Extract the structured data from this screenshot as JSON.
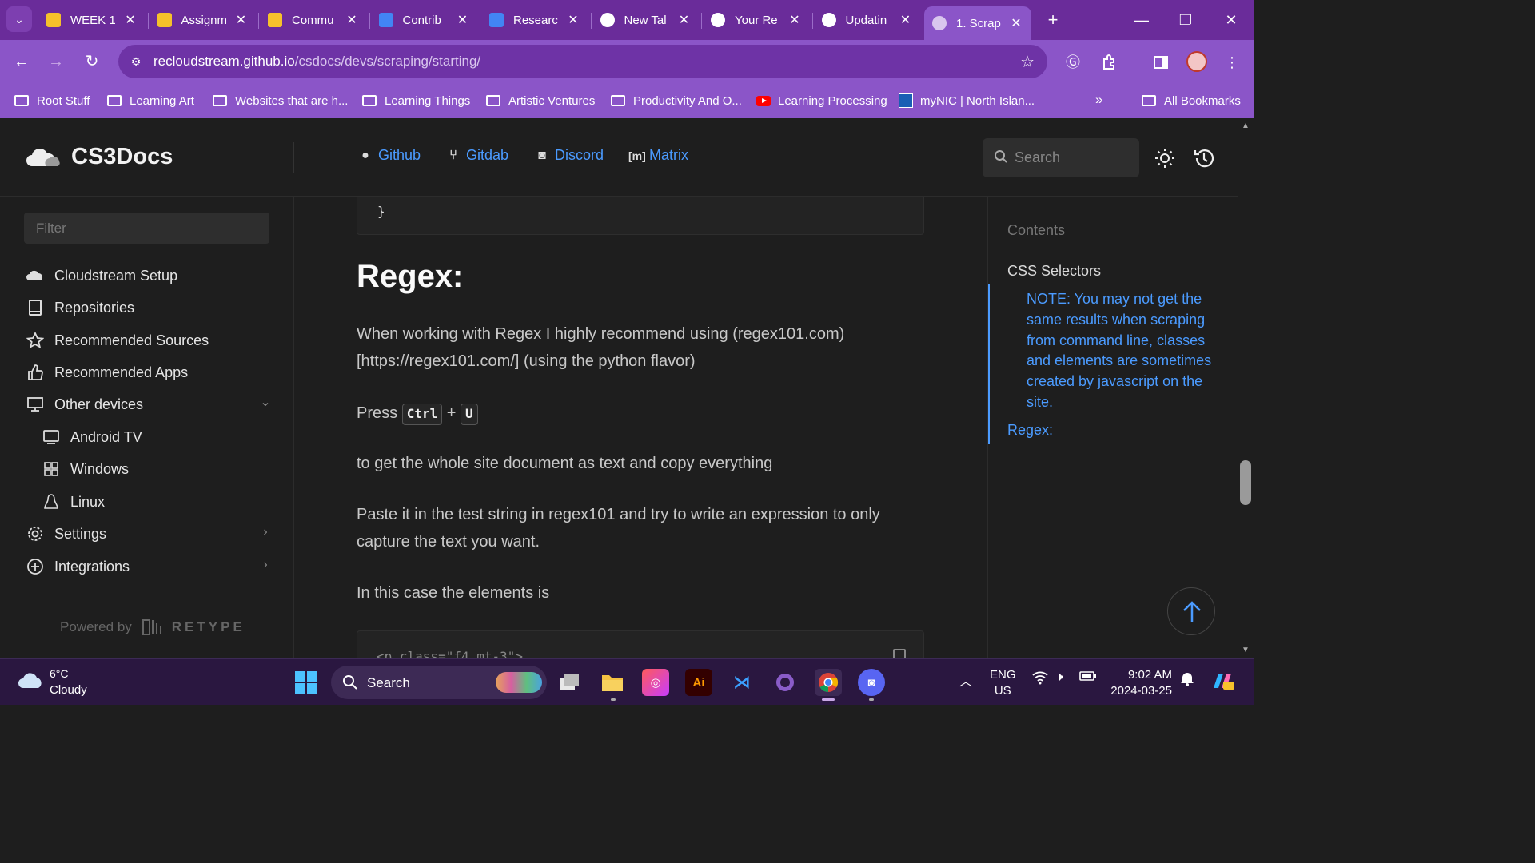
{
  "browser": {
    "tabs": [
      {
        "title": "WEEK 1",
        "icon": "kanban-icon"
      },
      {
        "title": "Assignm",
        "icon": "kanban-icon"
      },
      {
        "title": "Commu",
        "icon": "kanban-icon"
      },
      {
        "title": "Contrib",
        "icon": "docs-icon"
      },
      {
        "title": "Researc",
        "icon": "docs-icon"
      },
      {
        "title": "New Tal",
        "icon": "chrome-icon"
      },
      {
        "title": "Your Re",
        "icon": "github-icon"
      },
      {
        "title": "Updatin",
        "icon": "github-icon"
      },
      {
        "title": "1. Scrap",
        "icon": "globe-icon",
        "active": true
      }
    ],
    "url_host": "recloudstream.github.io",
    "url_path": "/csdocs/devs/scraping/starting/",
    "bookmarks": [
      "Root Stuff",
      "Learning Art",
      "Websites that are h...",
      "Learning Things",
      "Artistic Ventures",
      "Productivity And O...",
      "Learning Processing",
      "myNIC | North Islan..."
    ],
    "all_bookmarks": "All Bookmarks",
    "accent_color": "#8b55c8",
    "tabstrip_color": "#6a2c9a"
  },
  "site": {
    "name": "CS3Docs",
    "header_links": [
      {
        "label": "Github",
        "icon": "github-icon"
      },
      {
        "label": "Gitdab",
        "icon": "gitdab-icon"
      },
      {
        "label": "Discord",
        "icon": "discord-icon"
      },
      {
        "label": "Matrix",
        "icon": "matrix-icon"
      }
    ],
    "search_placeholder": "Search",
    "link_color": "#4b9bff"
  },
  "sidebar": {
    "filter_placeholder": "Filter",
    "items": [
      {
        "label": "Cloudstream Setup",
        "icon": "cloud-icon"
      },
      {
        "label": "Repositories",
        "icon": "book-icon"
      },
      {
        "label": "Recommended Sources",
        "icon": "star-icon"
      },
      {
        "label": "Recommended Apps",
        "icon": "thumbs-up-icon"
      },
      {
        "label": "Other devices",
        "icon": "monitor-icon",
        "expanded": true
      },
      {
        "label": "Android TV",
        "icon": "tv-icon",
        "sub": true
      },
      {
        "label": "Windows",
        "icon": "windows-icon",
        "sub": true
      },
      {
        "label": "Linux",
        "icon": "linux-icon",
        "sub": true
      },
      {
        "label": "Settings",
        "icon": "gear-icon",
        "has_children": true
      },
      {
        "label": "Integrations",
        "icon": "plus-circle-icon",
        "has_children": true
      }
    ],
    "powered_by": "Powered by",
    "retype": "RETYPE"
  },
  "content": {
    "code_top": "}",
    "heading": "Regex:",
    "p1": "When working with Regex I highly recommend using (regex101.com) [https://regex101.com/] (using the python flavor)",
    "press": "Press",
    "key1": "Ctrl",
    "plus": "+",
    "key2": "U",
    "p2": "to get the whole site document as text and copy everything",
    "p3": "Paste it in the test string in regex101 and try to write an expression to only capture the text you want.",
    "p4": "In this case the elements is",
    "code_bottom": "<p class=\"f4 mt-3\">"
  },
  "toc": {
    "title": "Contents",
    "item1": "CSS Selectors",
    "note": "NOTE: You may not get the same results when scraping from command line, classes and elements are sometimes created by javascript on the site.",
    "item2": "Regex:"
  },
  "taskbar": {
    "temp": "6°C",
    "condition": "Cloudy",
    "search": "Search",
    "lang1": "ENG",
    "lang2": "US",
    "time": "9:02 AM",
    "date": "2024-03-25"
  }
}
